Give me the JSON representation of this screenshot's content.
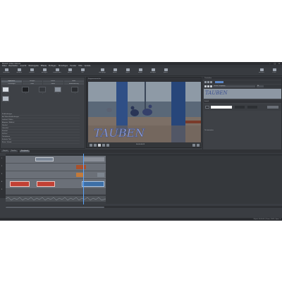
{
  "app": {
    "title": "MAGIX Video deluxe"
  },
  "menu": [
    "Datei",
    "Bearbeiten",
    "Ansicht",
    "Wiedergabe",
    "Effekte",
    "Einfügen",
    "Hinzufügen",
    "Fenster",
    "Hilfe",
    "Update"
  ],
  "toolbar": [
    "Schneiden",
    "Trimmen",
    "Löschen",
    "Einfügen",
    "Zuschneiden",
    "Effekte",
    "Titel",
    "Übergänge",
    "Audio",
    "Objekt",
    "Export",
    "Vorlagen",
    "Marker",
    "Brennen",
    "Teilen"
  ],
  "left_panel": {
    "tabs": [
      "Importieren",
      "Vorlagen",
      "Effekte",
      "Audio",
      "Titelvorlagen",
      "Fotos",
      "Videos",
      "Bildbearbeitung"
    ],
    "thumbs": [
      "Vorlage 1",
      "Vorlage 2",
      "Vorlage 3",
      "Vorlage 4",
      "Vorlage 5",
      "Vorlage 6"
    ],
    "categories": [
      "Einblendungen",
      "Auf Video-Einblendungen",
      "Lauftext / Rollen",
      "Abspann / Bildtitel",
      "Filmtitel",
      "Untertitel",
      "Kinotitel",
      "3D-Titel",
      "Textrahmen",
      "Einfache Titel",
      "Reise / Urlaub"
    ]
  },
  "preview": {
    "tab_label": "Programmmonitor",
    "overlay_text": "TAUBEN",
    "timecode": "00:00:04:19"
  },
  "props_panel": {
    "header": "Titeleditor",
    "preview_text": "TAUBEN",
    "section_label": "Schrift",
    "font_name": "Lucida Calligraphy",
    "size": "96",
    "bottom_label": "Titelanimation"
  },
  "timeline": {
    "tabs": [
      "Projekt",
      "Timeline",
      "Storyboard"
    ],
    "track_labels": [
      "1",
      "2",
      "3",
      "4",
      "5"
    ]
  },
  "status": {
    "left": "",
    "right": "Objekt: 00:00:00 | Zoom: 100% | Spur: 1"
  }
}
